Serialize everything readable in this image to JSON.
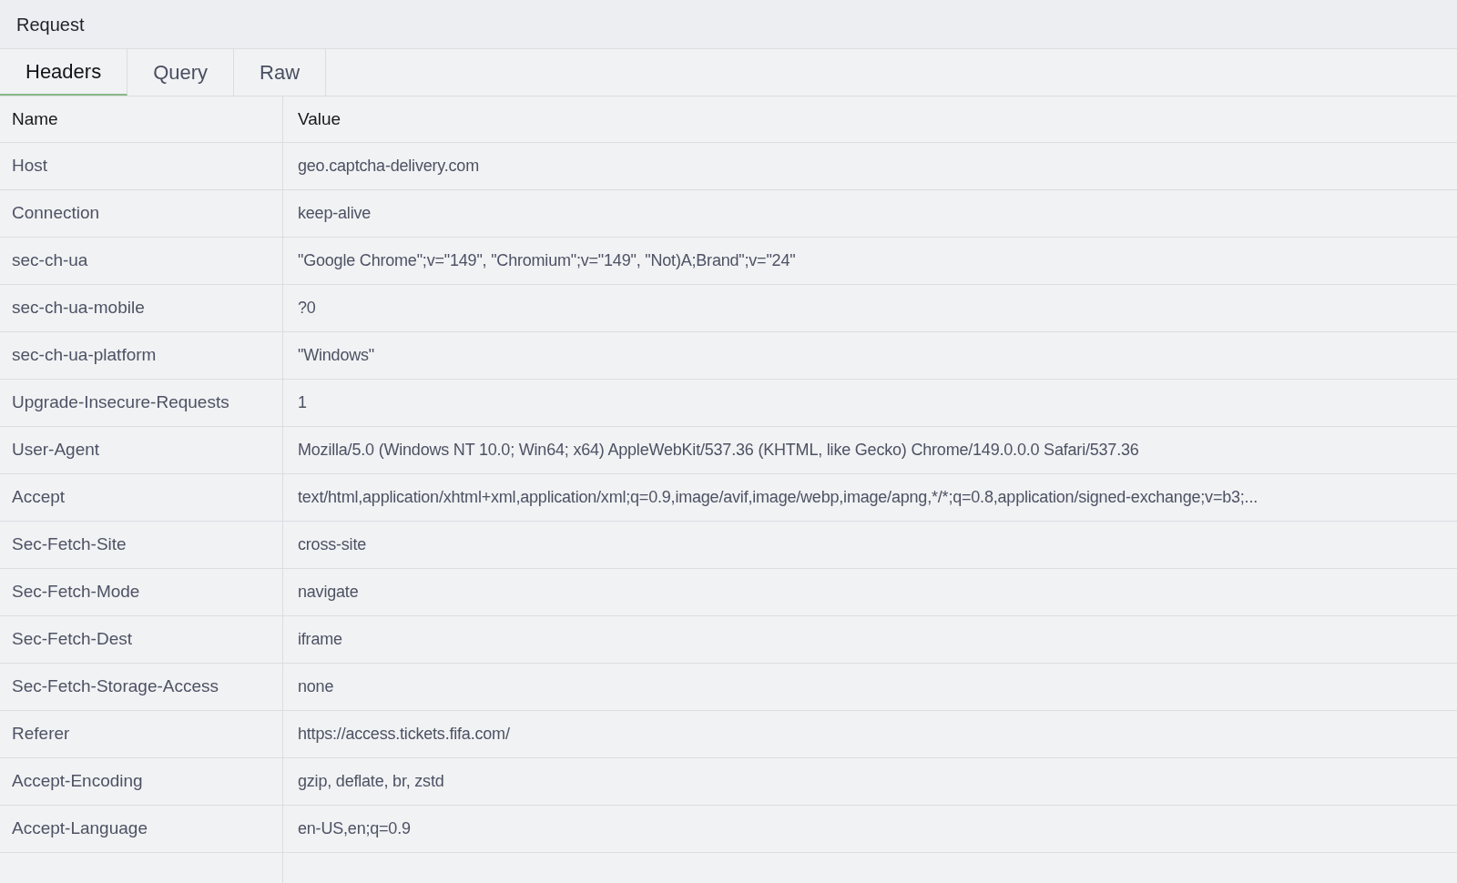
{
  "panel": {
    "title": "Request"
  },
  "tabs": [
    {
      "label": "Headers",
      "selected": true
    },
    {
      "label": "Query",
      "selected": false
    },
    {
      "label": "Raw",
      "selected": false
    }
  ],
  "table": {
    "columns": [
      "Name",
      "Value"
    ],
    "rows": [
      {
        "name": "Host",
        "value": "geo.captcha-delivery.com"
      },
      {
        "name": "Connection",
        "value": "keep-alive"
      },
      {
        "name": "sec-ch-ua",
        "value": "\"Google Chrome\";v=\"149\", \"Chromium\";v=\"149\", \"Not)A;Brand\";v=\"24\""
      },
      {
        "name": "sec-ch-ua-mobile",
        "value": "?0"
      },
      {
        "name": "sec-ch-ua-platform",
        "value": "\"Windows\""
      },
      {
        "name": "Upgrade-Insecure-Requests",
        "value": "1"
      },
      {
        "name": "User-Agent",
        "value": "Mozilla/5.0 (Windows NT 10.0; Win64; x64) AppleWebKit/537.36 (KHTML, like Gecko) Chrome/149.0.0.0 Safari/537.36"
      },
      {
        "name": "Accept",
        "value": "text/html,application/xhtml+xml,application/xml;q=0.9,image/avif,image/webp,image/apng,*/*;q=0.8,application/signed-exchange;v=b3;..."
      },
      {
        "name": "Sec-Fetch-Site",
        "value": "cross-site"
      },
      {
        "name": "Sec-Fetch-Mode",
        "value": "navigate"
      },
      {
        "name": "Sec-Fetch-Dest",
        "value": "iframe"
      },
      {
        "name": "Sec-Fetch-Storage-Access",
        "value": "none"
      },
      {
        "name": "Referer",
        "value": "https://access.tickets.fifa.com/"
      },
      {
        "name": "Accept-Encoding",
        "value": "gzip, deflate, br, zstd"
      },
      {
        "name": "Accept-Language",
        "value": "en-US,en;q=0.9"
      }
    ]
  }
}
